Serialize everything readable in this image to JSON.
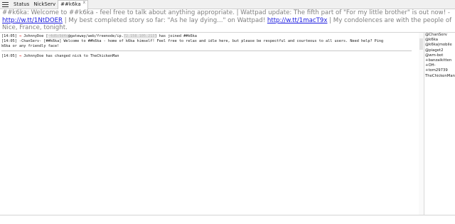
{
  "tabs": [
    {
      "label": "Status",
      "active": false,
      "closable": false
    },
    {
      "label": "NickServ",
      "active": false,
      "closable": false
    },
    {
      "label": "##k6ka",
      "active": true,
      "closable": true
    }
  ],
  "topic": {
    "part1": "##k6ka: Welcome to ##k6ka - feel free to talk about anything appropriate. | Wattpad update: The fifth part of \"For my little brother\" is out now! -",
    "link1": "http://w.tt/1NtDOER",
    "part2": " | My best completed story so far: \"As he lay dying...\" on Wattpad! ",
    "link2": "http://w.tt/1macT9x",
    "part3": " | My condolences are with the people of Nice, France, tonight."
  },
  "messages": {
    "m1": {
      "time": "[14:05]",
      "arrow": " ⇒ ",
      "pre": "JohnnyDoe [",
      "masked1": "~4d6c9d4c",
      "mid": "@gateway/web/freenode/ip.",
      "masked2": "72.158.105.213",
      "post": "] has joined ##k6ka"
    },
    "m2": {
      "line1": "[14:05] -ChanServ- [##k6ka] Welcome to ##k6ka - home of k6ka himself! Feel free to relax and idle here, but please be respectful and courteous to all users. Need help? Ping",
      "line2": "k6ka or any friendly face!"
    },
    "m3": {
      "time": "[14:05]",
      "arrow": " ⇒ ",
      "text": "JohnnyDoe has changed nick to TheChickenMan"
    }
  },
  "nicks": [
    "@ChanServ",
    "@k6ka",
    "@k6ka|mobile",
    "@piaget2",
    "@wm-bot",
    "+banzaikitten",
    "+OH-",
    "+tom29739",
    "TheChickenMan"
  ]
}
